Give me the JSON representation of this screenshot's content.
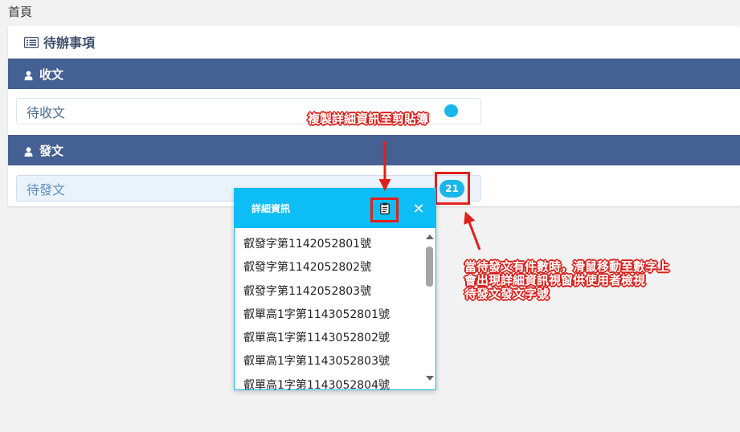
{
  "breadcrumb": "首頁",
  "panel": {
    "title": "待辦事項",
    "icon": "list-icon"
  },
  "sections": {
    "received": {
      "header": "收文",
      "item_label": "待收文"
    },
    "sent": {
      "header": "發文",
      "item_label": "待發文",
      "count": "21"
    }
  },
  "popup": {
    "title": "詳細資訊",
    "copy_icon": "clipboard-icon",
    "close_label": "✕",
    "items": [
      "叡發字第1142052801號",
      "叡發字第1142052802號",
      "叡發字第1142052803號",
      "叡單高1字第1143052801號",
      "叡單高1字第1143052802號",
      "叡單高1字第1143052803號",
      "叡單高1字第1143052804號"
    ]
  },
  "annotations": {
    "copy_hint": "複製詳細資訊至剪貼簿",
    "hover_hint_lines": [
      "當待發文有件數時，滑鼠移動至數字上",
      "會出現詳細資訊視窗供使用者檢視",
      "待發文發文字號"
    ]
  },
  "colors": {
    "section_bar": "#456093",
    "badge": "#1ab6ea",
    "popup_header": "#0dbdf5",
    "annotation_red": "#e0201b"
  }
}
